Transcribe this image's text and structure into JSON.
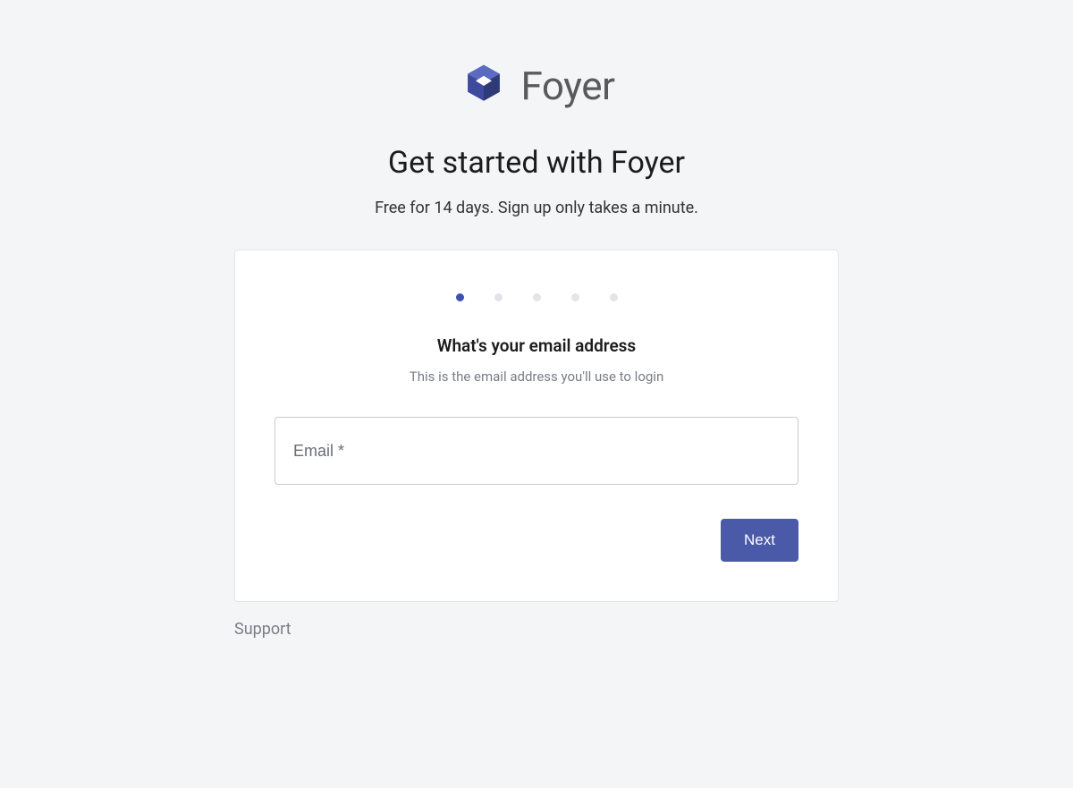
{
  "brand": {
    "name": "Foyer"
  },
  "header": {
    "title": "Get started with Foyer",
    "subtitle": "Free for 14 days. Sign up only takes a minute."
  },
  "stepper": {
    "total_steps": 5,
    "active_step": 1
  },
  "form": {
    "step_title": "What's your email address",
    "step_subtitle": "This is the email address you'll use to login",
    "email_placeholder": "Email *",
    "email_value": "",
    "next_label": "Next"
  },
  "footer": {
    "support_label": "Support"
  },
  "colors": {
    "accent": "#4a5aa8",
    "background": "#f4f5f7"
  }
}
